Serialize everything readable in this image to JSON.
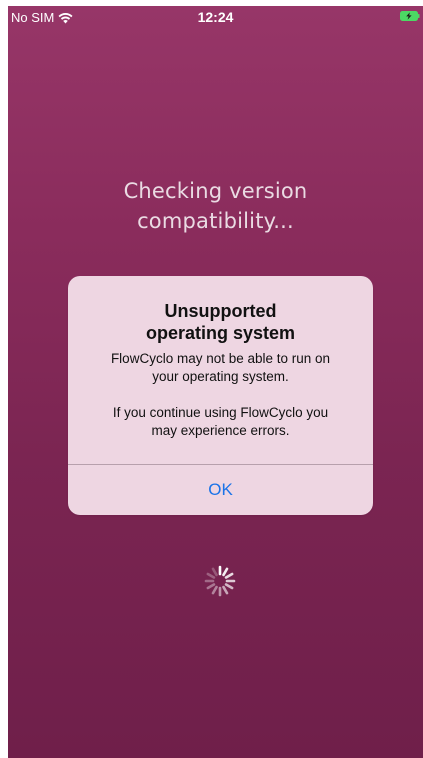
{
  "status_bar": {
    "carrier": "No SIM",
    "time": "12:24",
    "wifi_icon": "wifi-icon",
    "battery_icon": "battery-charging-icon"
  },
  "screen": {
    "background_top": "#973668",
    "background_bottom": "#6f1f4a",
    "message_line1": "Checking version",
    "message_line2": "compatibility..."
  },
  "alert": {
    "title_line1": "Unsupported",
    "title_line2": "operating system",
    "message_line1": "FlowCyclo may not be able to run on",
    "message_line2": "your operating system.",
    "message_line3": "If you continue using FlowCyclo you",
    "message_line4": "may experience errors.",
    "ok_label": "OK",
    "accent_color": "#1a73e8"
  },
  "loading": {
    "icon": "spinner-icon"
  }
}
